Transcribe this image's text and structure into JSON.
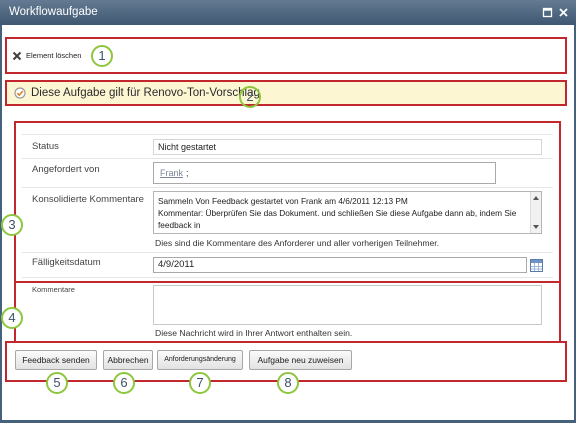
{
  "window": {
    "title": "Workflowaufgabe",
    "maximize_icon": "maximize-icon",
    "close_icon": "close-icon"
  },
  "ribbon": {
    "delete_icon": "delete-x-icon",
    "delete_label": "Element löschen"
  },
  "banner": {
    "icon": "task-check-icon",
    "text": "Diese Aufgabe gilt für Renovo-Ton-Vorschlag"
  },
  "form": {
    "status": {
      "label": "Status",
      "value": "Nicht gestartet"
    },
    "requested_by": {
      "label": "Angefordert von",
      "user": "Frank",
      "separator": ";"
    },
    "consolidated_comments": {
      "label": "Konsolidierte Kommentare",
      "lines": [
        "Sammeln Von Feedback gestartet von Frank am 4/6/2011 12:13 PM",
        "Kommentar: Überprüfen Sie das Dokument. und schließen Sie diese Aufgabe dann ab, indem Sie",
        "feedback in"
      ],
      "hint": "Dies sind die Kommentare des Anforderer und aller vorherigen Teilnehmer."
    },
    "due_date": {
      "label": "Fälligkeitsdatum",
      "value": "4/9/2011",
      "icon": "calendar-icon"
    },
    "comments": {
      "label": "Kommentare",
      "hint": "Diese Nachricht wird in Ihrer Antwort enthalten sein."
    }
  },
  "buttons": {
    "send_feedback": "Feedback senden",
    "cancel": "Abbrechen",
    "request_change": "Anforderungsänderung",
    "reassign": "Aufgabe neu zuweisen"
  },
  "callouts": [
    "1",
    "2",
    "3",
    "4",
    "5",
    "6",
    "7",
    "8"
  ],
  "colors": {
    "title_bar": "#46617e",
    "highlight_box": "#c1272d",
    "callout_ring": "#8dc63f",
    "banner_background": "#fdf6d3"
  }
}
